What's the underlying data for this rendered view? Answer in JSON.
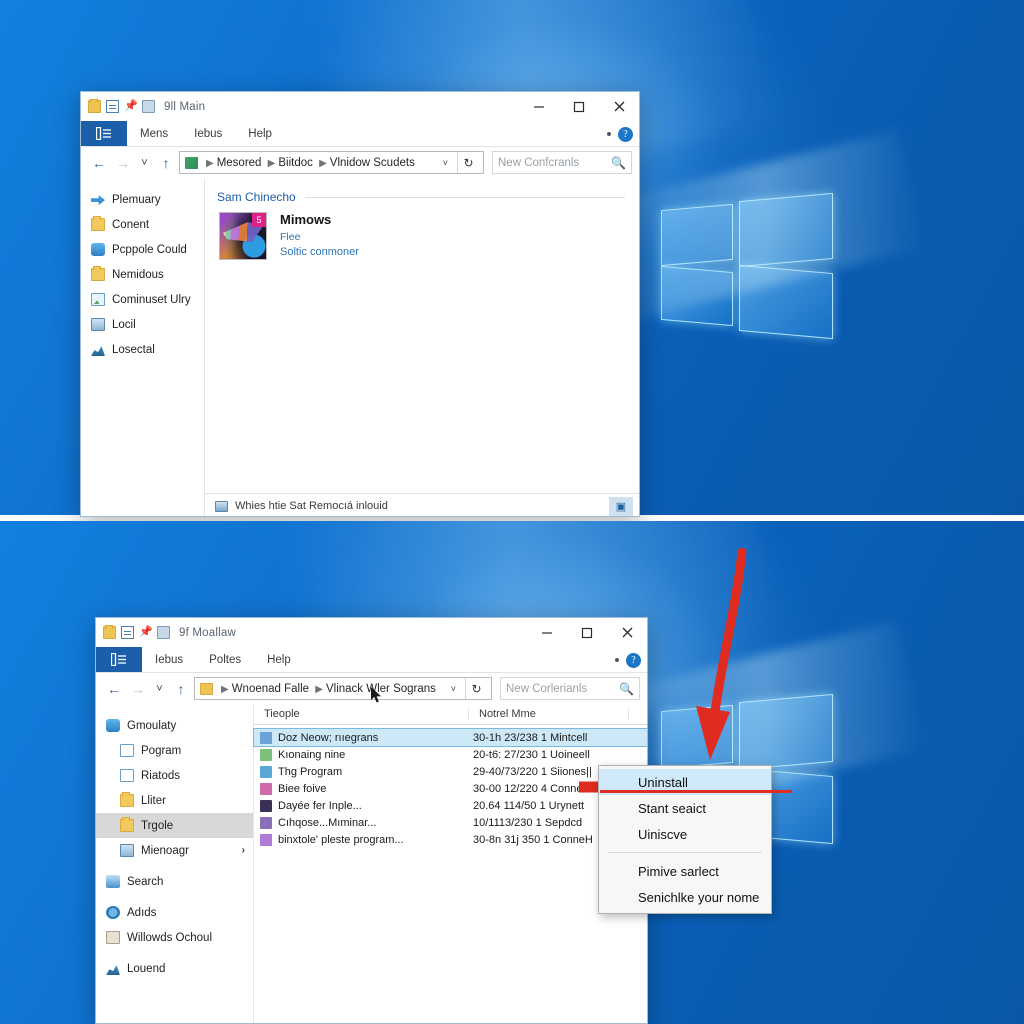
{
  "meta": {
    "accent_blue": "#1a5fa8",
    "annotation_red": "#e02b20",
    "selection_blue": "#cde8f7",
    "desktop_blue": "#0b62bc"
  },
  "top_window": {
    "title": "9ll Main",
    "title_icons": [
      "folder-icon",
      "document-icon",
      "pin-icon",
      "folder-small-icon"
    ],
    "window_buttons": {
      "minimize": "minimize-icon",
      "maximize": "maximize-icon",
      "close": "close-icon"
    },
    "ribbon": {
      "file_tab": "file-tab-icon",
      "tabs": [
        "Mens",
        "Iebus",
        "Help"
      ],
      "overflow_dot": "overflow-dot",
      "help_orb": "?"
    },
    "address_bar": {
      "back": "back-arrow-icon",
      "forward": "forward-arrow-icon",
      "recent": "chevron-down-icon",
      "up": "up-arrow-icon",
      "icon": "green-drive-icon",
      "crumbs": [
        "Mesored",
        "Biitdoc",
        "Vlnidow Scudets"
      ],
      "dropdown": "chevron-down-icon",
      "refresh": "refresh-icon"
    },
    "search": {
      "placeholder": "New Confcranls",
      "icon": "search-icon"
    },
    "nav_pane": [
      {
        "label": "Plemuary",
        "icon": "quick-access-icon"
      },
      {
        "label": "Conent",
        "icon": "folder-icon"
      },
      {
        "label": "Pcppole Could",
        "icon": "cloud-icon"
      },
      {
        "label": "Nemidous",
        "icon": "folder-icon"
      },
      {
        "label": "Cominuset Ulry",
        "icon": "picture-icon"
      },
      {
        "label": "Locil",
        "icon": "monitor-icon"
      },
      {
        "label": "Losectal",
        "icon": "network-icon"
      }
    ],
    "content": {
      "section_label": "Sam Chinecho",
      "tile": {
        "name": "Mimows",
        "sub": "Flee",
        "sub2": "Soltic conmoner",
        "badge": "5",
        "icon": "app-thumbnail"
      }
    },
    "status_bar": {
      "text": "Whies htie Sat Remocıá inlouid",
      "icon": "computer-icon",
      "right_icon": "view-layout-icon"
    }
  },
  "bottom_window": {
    "title": "9f Moallaw",
    "title_icons": [
      "folder-icon",
      "document-icon",
      "pin-icon",
      "folder-small-icon"
    ],
    "ribbon": {
      "file_tab": "file-tab-icon",
      "tabs": [
        "Iebus",
        "Poltes",
        "Help"
      ],
      "help_orb": "?"
    },
    "address_bar": {
      "icon": "manila-folder-icon",
      "crumbs": [
        "Wnoenad Falle",
        "Vlinack Wler Sograns"
      ]
    },
    "search": {
      "placeholder": "New Corlerianls",
      "icon": "search-icon"
    },
    "nav_pane": [
      {
        "label": "Gmoulaty",
        "icon": "cloud-icon",
        "indent": false,
        "selected": false
      },
      {
        "label": "Pogram",
        "icon": "folder-doc-icon",
        "indent": true,
        "selected": false
      },
      {
        "label": "Riatods",
        "icon": "document-icon",
        "indent": true,
        "selected": false
      },
      {
        "label": "Lliter",
        "icon": "folder-icon",
        "indent": true,
        "selected": false
      },
      {
        "label": "Trgole",
        "icon": "folder-icon",
        "indent": true,
        "selected": true
      },
      {
        "label": "Mienoagr",
        "icon": "monitor-icon",
        "indent": true,
        "selected": false,
        "chevron": "›"
      },
      {
        "label": "Search",
        "icon": "search-folder-icon",
        "indent": false,
        "selected": false
      },
      {
        "label": "Adıds",
        "icon": "gear-icon",
        "indent": false,
        "selected": false
      },
      {
        "label": "Willowds Ochoul",
        "icon": "archive-icon",
        "indent": false,
        "selected": false
      },
      {
        "label": "Louend",
        "icon": "network-icon",
        "indent": false,
        "selected": false
      }
    ],
    "file_list": {
      "columns": [
        "Tieople",
        "Notrel Mme",
        ""
      ],
      "rows": [
        {
          "name": "Doz Neow; rııegrans",
          "date": "30-1h 23/238 1 Mintcell",
          "icon_color": "#6ba2d8",
          "selected": true
        },
        {
          "name": "Kıonaing nine",
          "date": "20-t6: 27/230 1 Uoineell",
          "icon_color": "#7cc07a",
          "selected": false
        },
        {
          "name": "Thg Program",
          "date": "29-40/73/220 1 Siiones||",
          "icon_color": "#5aa8d8",
          "selected": false
        },
        {
          "name": "Biee foive",
          "date": "30-00 12/220 4 Connex",
          "icon_color": "#d06aa8",
          "selected": false
        },
        {
          "name": "Dayée fer Inple...",
          "date": "20.64 114/50 1 Urynett",
          "icon_color": "#3a2f55",
          "selected": false
        },
        {
          "name": "Cıhqose...Mıminar...",
          "date": "10/1113/230 1 Sepdcd",
          "icon_color": "#8a6fb8",
          "selected": false
        },
        {
          "name": "binxtole' pleste program...",
          "date": "30-8n 31j 350 1 ConneH",
          "icon_color": "#b07ad8",
          "selected": false
        }
      ]
    },
    "context_menu": {
      "items": [
        {
          "label": "Uninstall",
          "highlighted": true
        },
        {
          "label": "Stant seaict",
          "highlighted": false
        },
        {
          "label": "Uiniscve",
          "highlighted": false
        },
        {
          "separator": true
        },
        {
          "label": "Pimive sarlect",
          "highlighted": false
        },
        {
          "label": "Senichlke your nome",
          "highlighted": false
        }
      ]
    },
    "annotations": {
      "curved_arrow": "red-down-arrow",
      "pointer_arrow": "red-right-arrow",
      "underline": "red-underline"
    },
    "cursor": "mouse-pointer"
  }
}
